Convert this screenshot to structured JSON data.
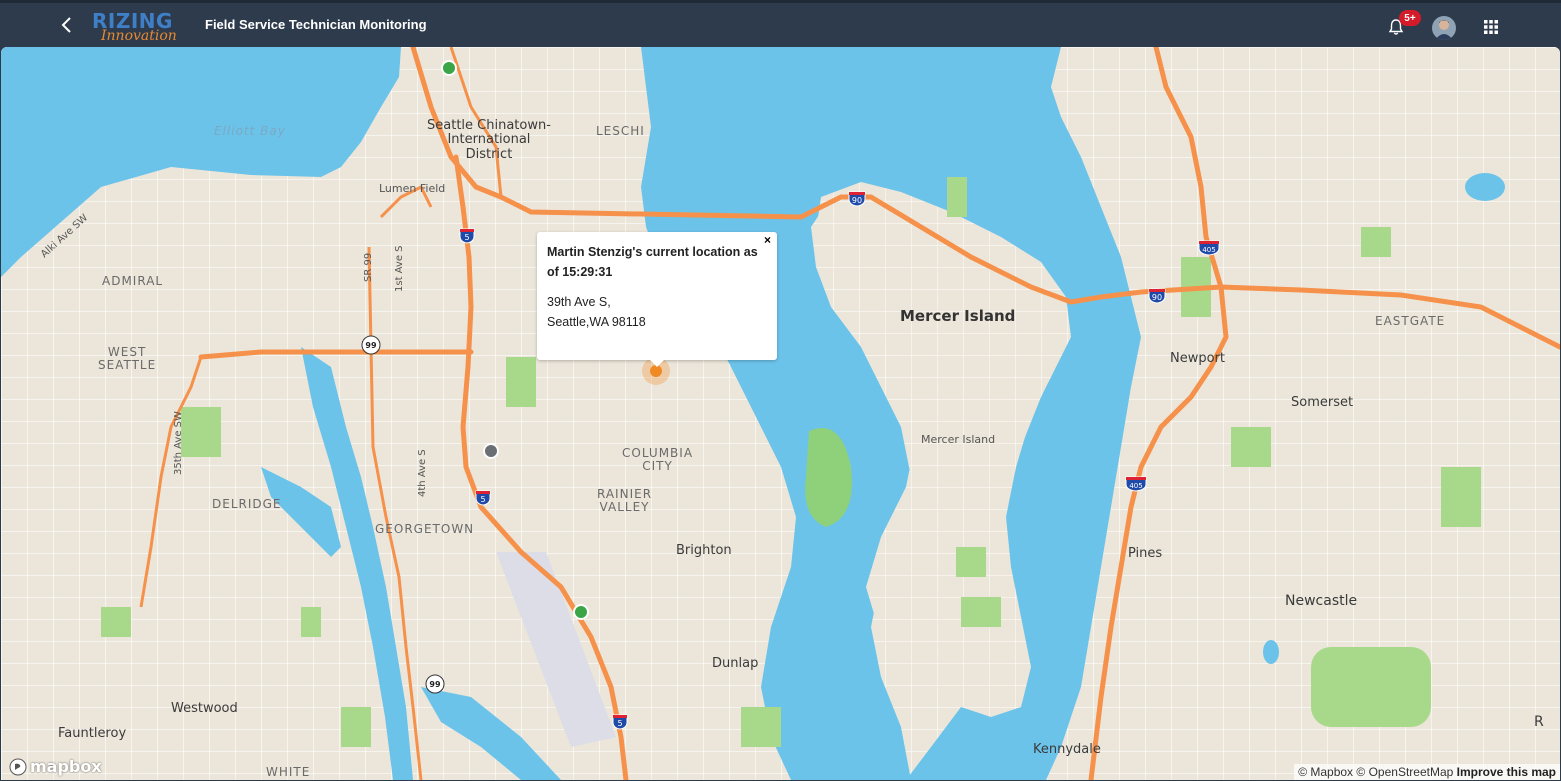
{
  "header": {
    "back_icon": "chevron-left-icon",
    "logo_top": "RIZING",
    "logo_bottom": "Innovation",
    "title": "Field Service Technician Monitoring",
    "notification_badge": "5+",
    "notification_icon": "bell-icon",
    "apps_icon": "grid-icon"
  },
  "map": {
    "labels": {
      "elliott_bay": "Elliott Bay",
      "chinatown": "Seattle Chinatown-\nInternational\nDistrict",
      "leschi": "LESCHI",
      "lumen_field": "Lumen Field",
      "alki": "Alki Ave SW",
      "admiral": "ADMIRAL",
      "west_seattle": "WEST\nSEATTLE",
      "sr99": "SR 99",
      "first_ave": "1st Ave S",
      "fourth_ave": "4th Ave S",
      "thirtyfifth": "35th Ave SW",
      "delridge": "DELRIDGE",
      "georgetown": "GEORGETOWN",
      "columbia_city": "COLUMBIA\nCITY",
      "rainier_valley": "RAINIER\nVALLEY",
      "brighton": "Brighton",
      "dunlap": "Dunlap",
      "westwood": "Westwood",
      "fauntleroy": "Fauntleroy",
      "white_center": "WHITE",
      "mercer_island_big": "Mercer Island",
      "mercer_island_small": "Mercer Island",
      "eastgate": "EASTGATE",
      "newport": "Newport",
      "somerset": "Somerset",
      "pines": "Pines",
      "newcastle": "Newcastle",
      "kennydale": "Kennydale",
      "renton": "R"
    },
    "shields": {
      "i90_a": "90",
      "i90_b": "90",
      "i405_a": "405",
      "i405_b": "405",
      "i5_a": "5",
      "i5_b": "5",
      "i5_c": "5",
      "sr99_a": "99",
      "sr99_b": "99"
    },
    "markers": [
      {
        "name": "technician-marker-north",
        "status": "active",
        "color": "#3aa648"
      },
      {
        "name": "technician-marker-gray",
        "status": "offline",
        "color": "#6b6f74"
      },
      {
        "name": "technician-marker-south",
        "status": "active",
        "color": "#3aa648"
      },
      {
        "name": "technician-marker-selected",
        "status": "selected",
        "color": "#f08a24"
      }
    ],
    "popup": {
      "title": "Martin Stenzig's current location as of 15:29:31",
      "address_line1": "39th Ave S,",
      "address_line2": "Seattle,WA 98118",
      "close": "×"
    },
    "attribution": {
      "mapbox": "© Mapbox",
      "osm": "© OpenStreetMap",
      "improve": "Improve this map"
    },
    "logo_text": "mapbox"
  },
  "colors": {
    "shell": "#2d3b4c",
    "water": "#6cc3ea",
    "land": "#ece6da",
    "highway": "#f5914a",
    "park": "#a8d98a"
  }
}
